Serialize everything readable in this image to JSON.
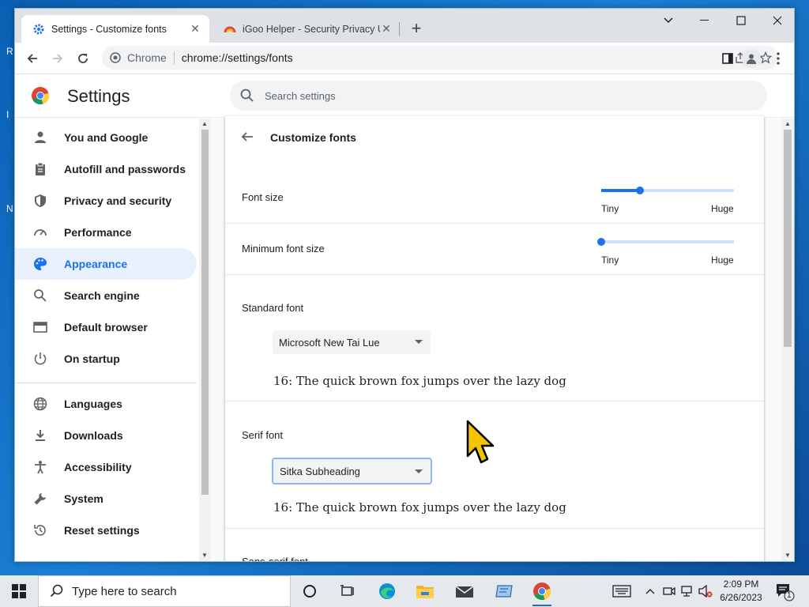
{
  "desktop": {
    "edge_letters": [
      "R",
      "I",
      "N"
    ]
  },
  "browser": {
    "tabs": [
      {
        "title": "Settings - Customize fonts",
        "active": true,
        "icon": "settings-gear-icon"
      },
      {
        "title": "iGoo Helper - Security Privacy Un",
        "active": false,
        "icon": "igoo-favicon-icon"
      }
    ],
    "omnibox": {
      "site_label": "Chrome",
      "url": "chrome://settings/fonts"
    }
  },
  "settings": {
    "title": "Settings",
    "search_placeholder": "Search settings",
    "nav": [
      {
        "label": "You and Google",
        "icon": "person-icon"
      },
      {
        "label": "Autofill and passwords",
        "icon": "clipboard-icon"
      },
      {
        "label": "Privacy and security",
        "icon": "shield-icon"
      },
      {
        "label": "Performance",
        "icon": "speedometer-icon"
      },
      {
        "label": "Appearance",
        "icon": "palette-icon",
        "selected": true
      },
      {
        "label": "Search engine",
        "icon": "search-icon"
      },
      {
        "label": "Default browser",
        "icon": "browser-window-icon"
      },
      {
        "label": "On startup",
        "icon": "power-icon"
      },
      {
        "label": "Languages",
        "icon": "globe-icon"
      },
      {
        "label": "Downloads",
        "icon": "download-icon"
      },
      {
        "label": "Accessibility",
        "icon": "accessibility-icon"
      },
      {
        "label": "System",
        "icon": "wrench-icon"
      },
      {
        "label": "Reset settings",
        "icon": "reset-icon"
      }
    ],
    "page": {
      "heading": "Customize fonts",
      "font_size": {
        "label": "Font size",
        "min_label": "Tiny",
        "max_label": "Huge",
        "level": 0.29
      },
      "min_font_size": {
        "label": "Minimum font size",
        "min_label": "Tiny",
        "max_label": "Huge",
        "level": 0.0
      },
      "standard_font": {
        "label": "Standard font",
        "value": "Microsoft New Tai Lue",
        "sample": "16: The quick brown fox jumps over the lazy dog"
      },
      "serif_font": {
        "label": "Serif font",
        "value": "Sitka Subheading",
        "sample": "16: The quick brown fox jumps over the lazy dog"
      },
      "sans_serif_font": {
        "label": "Sans-serif font"
      }
    }
  },
  "taskbar": {
    "search_placeholder": "Type here to search",
    "time": "2:09 PM",
    "date": "6/26/2023",
    "notification_count": "1"
  },
  "colors": {
    "accent": "#1a73e8",
    "selected_bg": "#e8f0fe"
  }
}
